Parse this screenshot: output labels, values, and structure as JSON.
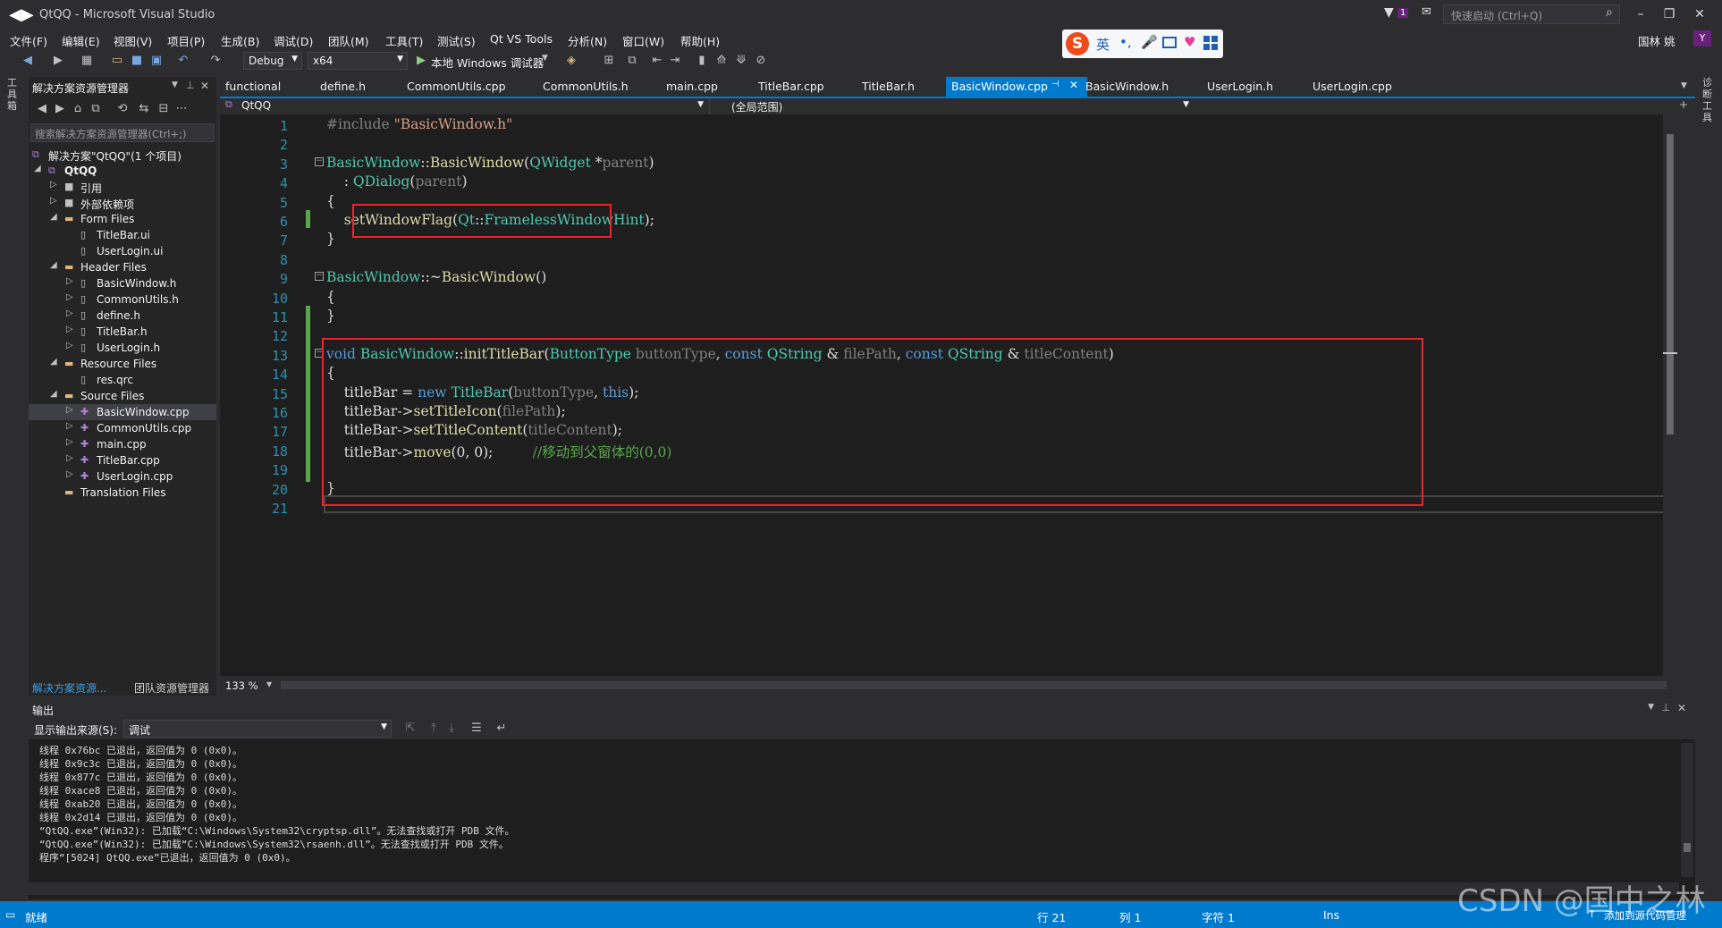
{
  "window": {
    "title": "QtQQ - Microsoft Visual Studio",
    "quick_launch": "快速启动 (Ctrl+Q)",
    "notif_count": "1",
    "user": "国林 姚",
    "user_initial": "Y"
  },
  "menu": [
    "文件(F)",
    "编辑(E)",
    "视图(V)",
    "项目(P)",
    "生成(B)",
    "调试(D)",
    "团队(M)",
    "工具(T)",
    "测试(S)",
    "Qt VS Tools",
    "分析(N)",
    "窗口(W)",
    "帮助(H)"
  ],
  "toolbar": {
    "config": "Debug",
    "platform": "x64",
    "run_label": "本地 Windows 调试器"
  },
  "ime": {
    "lang": "英"
  },
  "left_strip_label": "工具箱",
  "right_strip_label": "诊断工具",
  "solution_explorer": {
    "title": "解决方案资源管理器",
    "search_placeholder": "搜索解决方案资源管理器(Ctrl+;)",
    "items": [
      {
        "label": "解决方案\"QtQQ\"(1 个项目)",
        "indent": 0
      },
      {
        "label": "QtQQ",
        "indent": 1,
        "bold": true
      },
      {
        "label": "引用",
        "indent": 2
      },
      {
        "label": "外部依赖项",
        "indent": 2
      },
      {
        "label": "Form Files",
        "indent": 2
      },
      {
        "label": "TitleBar.ui",
        "indent": 3
      },
      {
        "label": "UserLogin.ui",
        "indent": 3
      },
      {
        "label": "Header Files",
        "indent": 2
      },
      {
        "label": "BasicWindow.h",
        "indent": 3
      },
      {
        "label": "CommonUtils.h",
        "indent": 3
      },
      {
        "label": "define.h",
        "indent": 3
      },
      {
        "label": "TitleBar.h",
        "indent": 3
      },
      {
        "label": "UserLogin.h",
        "indent": 3
      },
      {
        "label": "Resource Files",
        "indent": 2
      },
      {
        "label": "res.qrc",
        "indent": 3
      },
      {
        "label": "Source Files",
        "indent": 2
      },
      {
        "label": "BasicWindow.cpp",
        "indent": 3,
        "selected": true
      },
      {
        "label": "CommonUtils.cpp",
        "indent": 3
      },
      {
        "label": "main.cpp",
        "indent": 3
      },
      {
        "label": "TitleBar.cpp",
        "indent": 3
      },
      {
        "label": "UserLogin.cpp",
        "indent": 3
      },
      {
        "label": "Translation Files",
        "indent": 2
      }
    ],
    "bottom_tabs": [
      "解决方案资源...",
      "团队资源管理器"
    ]
  },
  "editor": {
    "tabs": [
      "functional",
      "define.h",
      "CommonUtils.cpp",
      "CommonUtils.h",
      "main.cpp",
      "TitleBar.cpp",
      "TitleBar.h",
      "BasicWindow.cpp",
      "BasicWindow.h",
      "UserLogin.h",
      "UserLogin.cpp"
    ],
    "active_tab": "BasicWindow.cpp",
    "nav_project": "QtQQ",
    "nav_scope": "(全局范围)",
    "zoom": "133 %",
    "line_numbers": [
      "1",
      "2",
      "3",
      "4",
      "5",
      "6",
      "7",
      "8",
      "9",
      "10",
      "11",
      "12",
      "13",
      "14",
      "15",
      "16",
      "17",
      "18",
      "19",
      "20",
      "21"
    ]
  },
  "output": {
    "title": "输出",
    "source_label": "显示输出来源(S):",
    "source_value": "调试",
    "lines": [
      "线程 0x76bc 已退出，返回值为 0 (0x0)。",
      "线程 0x9c3c 已退出，返回值为 0 (0x0)。",
      "线程 0x877c 已退出，返回值为 0 (0x0)。",
      "线程 0xace8 已退出，返回值为 0 (0x0)。",
      "线程 0xab20 已退出，返回值为 0 (0x0)。",
      "线程 0x2d14 已退出，返回值为 0 (0x0)。",
      "“QtQQ.exe”(Win32): 已加载“C:\\Windows\\System32\\cryptsp.dll”。无法查找或打开 PDB 文件。",
      "“QtQQ.exe”(Win32): 已加载“C:\\Windows\\System32\\rsaenh.dll”。无法查找或打开 PDB 文件。",
      "程序“[5024] QtQQ.exe”已退出，返回值为 0 (0x0)。"
    ]
  },
  "status": {
    "ready": "就绪",
    "row": "行 21",
    "col": "列 1",
    "char": "字符 1",
    "mode": "Ins",
    "source_control": "添加到源代码管理"
  },
  "watermark": "CSDN @国中之林"
}
